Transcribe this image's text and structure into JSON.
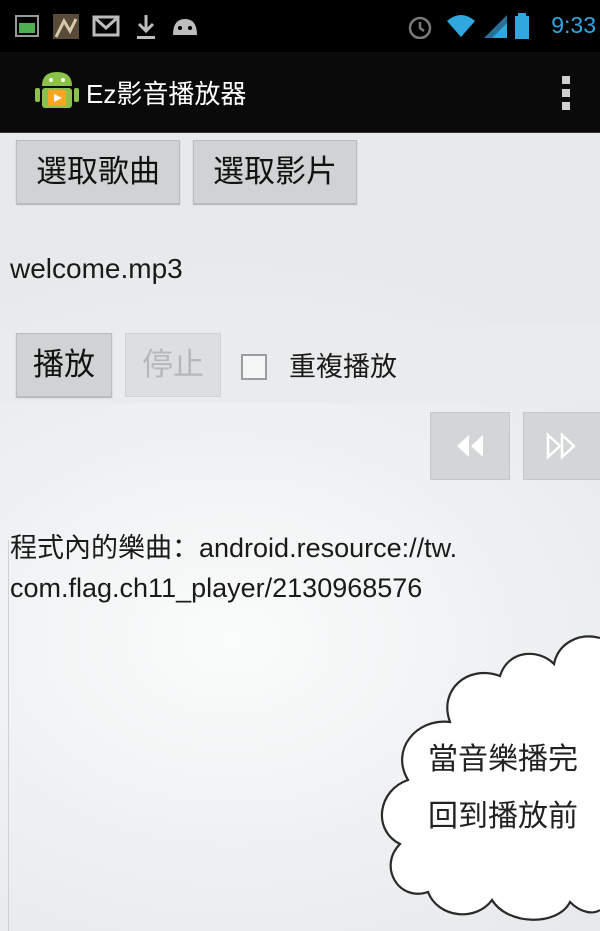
{
  "status_bar": {
    "time": "9:33",
    "left_icons": [
      "gallery-icon",
      "photo-thumbnail-icon",
      "gmail-icon",
      "download-icon",
      "android-debug-icon"
    ],
    "right_icons": [
      "alarm-icon",
      "wifi-icon",
      "signal-icon",
      "battery-icon"
    ],
    "time_color": "#2fa8e0"
  },
  "action_bar": {
    "app_title": "Ez影音播放器",
    "app_icon": "android-app-icon",
    "menu_icon": "overflow-menu-icon"
  },
  "buttons": {
    "select_song": "選取歌曲",
    "select_video": "選取影片",
    "play": "播放",
    "stop": "停止"
  },
  "current_file": "welcome.mp3",
  "repeat_checkbox": {
    "label": "重複播放",
    "checked": false
  },
  "nav": {
    "rewind_icon": "rewind-icon",
    "forward_icon": "fast-forward-icon"
  },
  "info": {
    "line1": "程式內的樂曲：android.resource://tw.",
    "line2": "com.flag.ch11_player/2130968576"
  },
  "callout": {
    "line1": "當音樂播完",
    "line2": "回到播放前"
  }
}
